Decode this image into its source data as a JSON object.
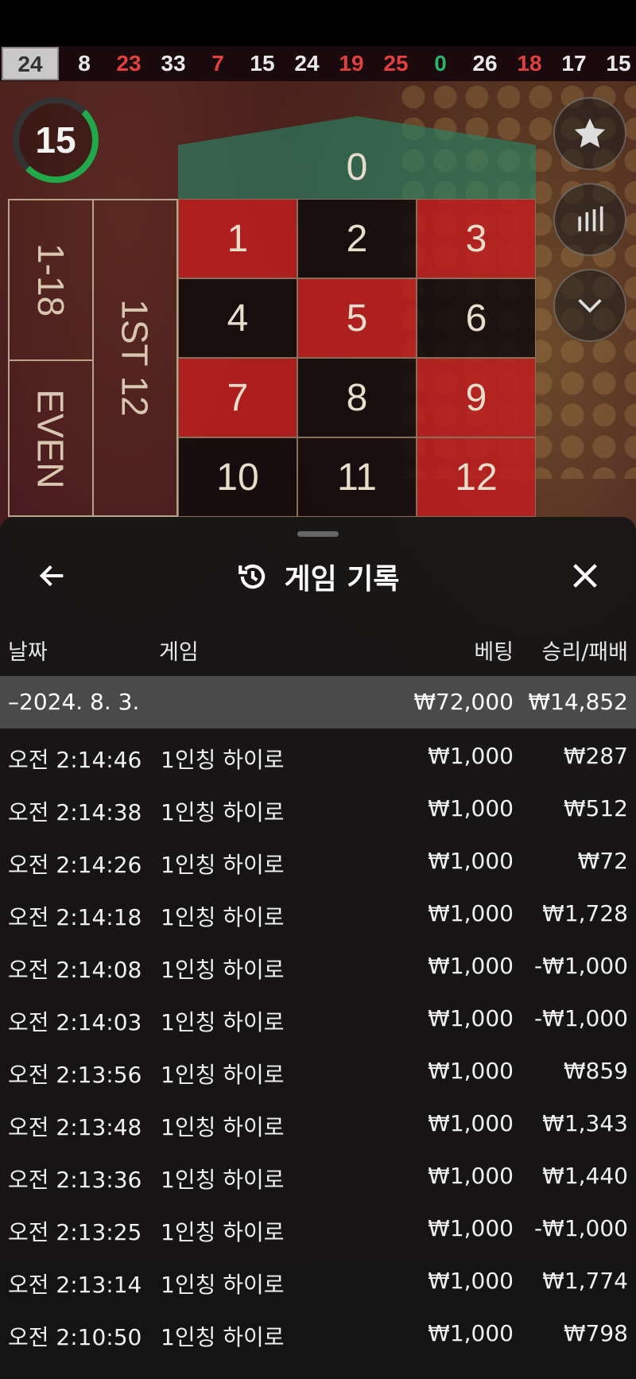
{
  "history": [
    "24",
    "8",
    "23",
    "33",
    "7",
    "15",
    "24",
    "19",
    "25",
    "0",
    "26",
    "18",
    "17",
    "15"
  ],
  "history_colors": [
    "black",
    "black",
    "red",
    "black",
    "red",
    "black",
    "black",
    "red",
    "red",
    "green",
    "black",
    "red",
    "black",
    "black"
  ],
  "timer": "15",
  "board": {
    "zero": "0",
    "cells": [
      {
        "n": "1",
        "c": "red"
      },
      {
        "n": "2",
        "c": "black"
      },
      {
        "n": "3",
        "c": "red"
      },
      {
        "n": "4",
        "c": "black"
      },
      {
        "n": "5",
        "c": "red"
      },
      {
        "n": "6",
        "c": "black"
      },
      {
        "n": "7",
        "c": "red"
      },
      {
        "n": "8",
        "c": "black"
      },
      {
        "n": "9",
        "c": "red"
      },
      {
        "n": "10",
        "c": "black"
      },
      {
        "n": "11",
        "c": "black"
      },
      {
        "n": "12",
        "c": "red"
      }
    ],
    "low_label": "1-18",
    "even_label": "EVEN",
    "dozen_label": "1ST 12"
  },
  "sheet": {
    "title": "게임 기록",
    "columns": {
      "date": "날짜",
      "game": "게임",
      "bet": "베팅",
      "result": "승리/패배"
    },
    "date_group": {
      "date": "–2024. 8. 3.",
      "bet_total": "₩72,000",
      "result_total": "₩14,852"
    },
    "rows": [
      {
        "time": "오전 2:14:46",
        "game": "1인칭 하이로",
        "bet": "₩1,000",
        "result": "₩287"
      },
      {
        "time": "오전 2:14:38",
        "game": "1인칭 하이로",
        "bet": "₩1,000",
        "result": "₩512"
      },
      {
        "time": "오전 2:14:26",
        "game": "1인칭 하이로",
        "bet": "₩1,000",
        "result": "₩72"
      },
      {
        "time": "오전 2:14:18",
        "game": "1인칭 하이로",
        "bet": "₩1,000",
        "result": "₩1,728"
      },
      {
        "time": "오전 2:14:08",
        "game": "1인칭 하이로",
        "bet": "₩1,000",
        "result": "-₩1,000"
      },
      {
        "time": "오전 2:14:03",
        "game": "1인칭 하이로",
        "bet": "₩1,000",
        "result": "-₩1,000"
      },
      {
        "time": "오전 2:13:56",
        "game": "1인칭 하이로",
        "bet": "₩1,000",
        "result": "₩859"
      },
      {
        "time": "오전 2:13:48",
        "game": "1인칭 하이로",
        "bet": "₩1,000",
        "result": "₩1,343"
      },
      {
        "time": "오전 2:13:36",
        "game": "1인칭 하이로",
        "bet": "₩1,000",
        "result": "₩1,440"
      },
      {
        "time": "오전 2:13:25",
        "game": "1인칭 하이로",
        "bet": "₩1,000",
        "result": "-₩1,000"
      },
      {
        "time": "오전 2:13:14",
        "game": "1인칭 하이로",
        "bet": "₩1,000",
        "result": "₩1,774"
      },
      {
        "time": "오전 2:10:50",
        "game": "1인칭 하이로",
        "bet": "₩1,000",
        "result": "₩798"
      }
    ]
  },
  "icons": {
    "back": "arrow-left-icon",
    "close": "close-icon",
    "history": "history-icon",
    "favorite": "star-icon",
    "stats": "bars-icon",
    "collapse": "chevron-down-icon"
  },
  "colors": {
    "red": "#be1e1e",
    "black": "#0f0a0c",
    "green": "#2bb36a",
    "sheet_bg": "#161616",
    "date_row_bg": "#4a4a4a"
  }
}
